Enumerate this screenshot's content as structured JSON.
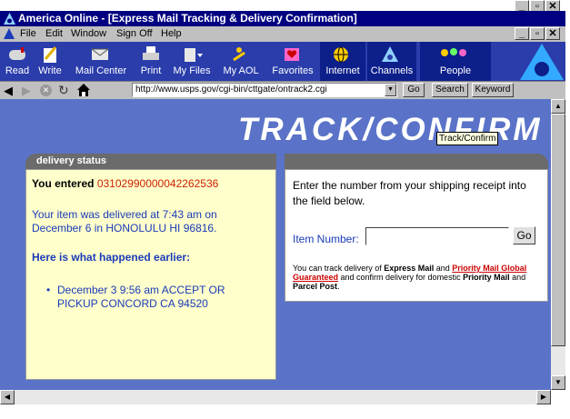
{
  "window": {
    "title": "America Online - [Express Mail Tracking & Delivery Confirmation]"
  },
  "menubar": {
    "items": [
      "File",
      "Edit",
      "Window",
      "Sign Off",
      "Help"
    ]
  },
  "toolbar": {
    "buttons": [
      "Read",
      "Write",
      "Mail Center",
      "Print",
      "My Files",
      "My AOL",
      "Favorites",
      "Internet",
      "Channels",
      "People"
    ]
  },
  "navbar": {
    "url": "http://www.usps.gov/cgi-bin/cttgate/ontrack2.cgi",
    "go_label": "Go",
    "search_label": "Search",
    "keyword_label": "Keyword"
  },
  "page": {
    "heading": "TRACK/CONFIRM",
    "tooltip": "Track/Confirm",
    "status": {
      "header": "delivery status",
      "entered_label": "You entered",
      "tracking_number": "03102990000042262536",
      "delivered_text": "Your item was delivered at 7:43 am on December 6 in HONOLULU HI 96816.",
      "earlier_heading": "Here is what happened earlier:",
      "events": [
        "December 3 9:56 am ACCEPT OR PICKUP CONCORD CA 94520"
      ]
    },
    "form": {
      "instructions": "Enter the number from your shipping receipt into the field below.",
      "item_label": "Item Number:",
      "item_value": "",
      "go_label": "Go",
      "info_1": "You can track delivery of ",
      "info_express": "Express Mail",
      "info_2": " and ",
      "info_priority_link": "Priority Mail Global Guaranteed",
      "info_3": " and confirm delivery for domestic ",
      "info_priority": "Priority Mail",
      "info_4": " and ",
      "info_parcel": "Parcel Post",
      "info_5": "."
    }
  },
  "colors": {
    "titlebar": "#000080",
    "toolbar": "#2a3dab",
    "content_bg": "#5a73c8",
    "status_panel": "#ffffcc",
    "panel_header": "#6b6b6b",
    "tracking_red": "#cc2200",
    "text_blue": "#1a3bb8"
  }
}
